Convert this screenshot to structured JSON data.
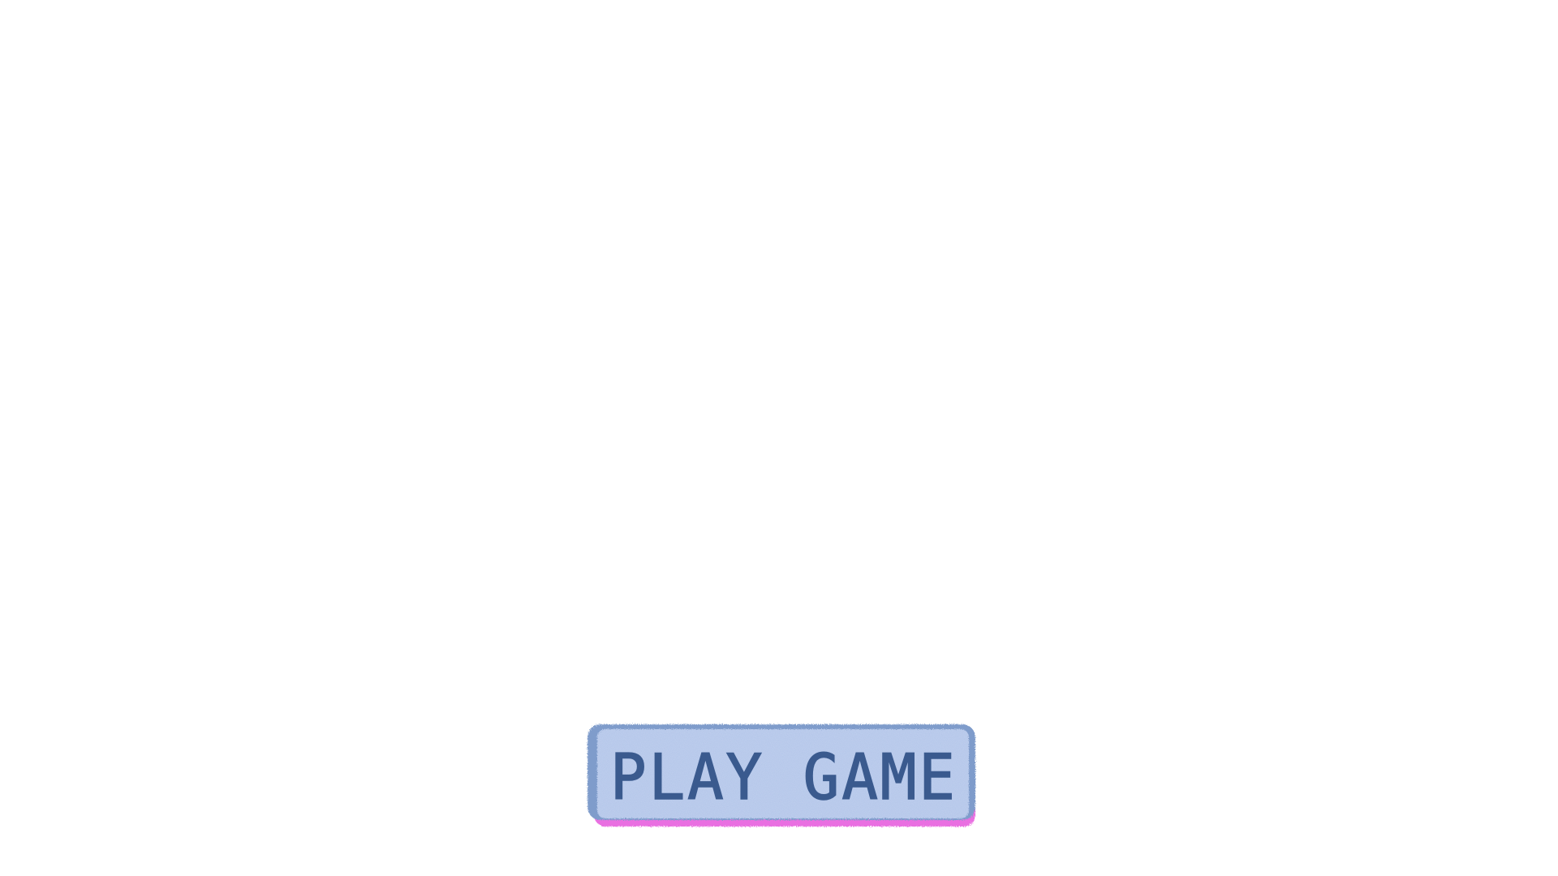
{
  "screen": {
    "background_color": "#ffffff"
  },
  "play_button": {
    "label": "PLAY GAME",
    "text_color": "#3a5a8e",
    "fill_color": "#b5c7ea",
    "shadow_color": "#e868e0",
    "edge_color": "#7f9ccb"
  }
}
